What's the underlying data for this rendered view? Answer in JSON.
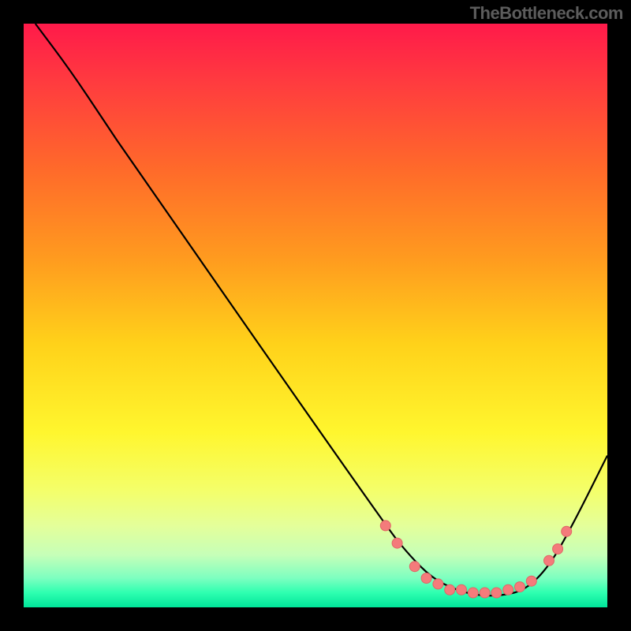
{
  "watermark": "TheBottleneck.com",
  "colors": {
    "dot_fill": "#f47b7b",
    "dot_stroke": "#e06666",
    "curve": "#000000"
  },
  "gradient_stops": [
    {
      "offset": 0.0,
      "color": "#ff1a4a"
    },
    {
      "offset": 0.1,
      "color": "#ff3b3f"
    },
    {
      "offset": 0.25,
      "color": "#ff6a2a"
    },
    {
      "offset": 0.4,
      "color": "#ff9a1f"
    },
    {
      "offset": 0.55,
      "color": "#ffd21a"
    },
    {
      "offset": 0.7,
      "color": "#fff62e"
    },
    {
      "offset": 0.8,
      "color": "#f4ff6a"
    },
    {
      "offset": 0.86,
      "color": "#e4ff9a"
    },
    {
      "offset": 0.91,
      "color": "#c6ffb8"
    },
    {
      "offset": 0.95,
      "color": "#7dffc0"
    },
    {
      "offset": 0.975,
      "color": "#2effb0"
    },
    {
      "offset": 1.0,
      "color": "#00e59a"
    }
  ],
  "chart_data": {
    "type": "line",
    "title": "",
    "xlabel": "",
    "ylabel": "",
    "x_range": [
      0,
      100
    ],
    "y_range": [
      0,
      100
    ],
    "curve": [
      {
        "x": 2,
        "y": 100
      },
      {
        "x": 8,
        "y": 92
      },
      {
        "x": 14,
        "y": 83
      },
      {
        "x": 18,
        "y": 77
      },
      {
        "x": 62,
        "y": 14
      },
      {
        "x": 66,
        "y": 9
      },
      {
        "x": 70,
        "y": 5
      },
      {
        "x": 74,
        "y": 3
      },
      {
        "x": 78,
        "y": 2
      },
      {
        "x": 82,
        "y": 2
      },
      {
        "x": 86,
        "y": 3
      },
      {
        "x": 90,
        "y": 7
      },
      {
        "x": 94,
        "y": 14
      },
      {
        "x": 100,
        "y": 26
      }
    ],
    "dots": [
      {
        "x": 62,
        "y": 14
      },
      {
        "x": 64,
        "y": 11
      },
      {
        "x": 67,
        "y": 7
      },
      {
        "x": 69,
        "y": 5
      },
      {
        "x": 71,
        "y": 4
      },
      {
        "x": 73,
        "y": 3
      },
      {
        "x": 75,
        "y": 3
      },
      {
        "x": 77,
        "y": 2.5
      },
      {
        "x": 79,
        "y": 2.5
      },
      {
        "x": 81,
        "y": 2.5
      },
      {
        "x": 83,
        "y": 3
      },
      {
        "x": 85,
        "y": 3.5
      },
      {
        "x": 87,
        "y": 4.5
      },
      {
        "x": 90,
        "y": 8
      },
      {
        "x": 91.5,
        "y": 10
      },
      {
        "x": 93,
        "y": 13
      }
    ]
  }
}
